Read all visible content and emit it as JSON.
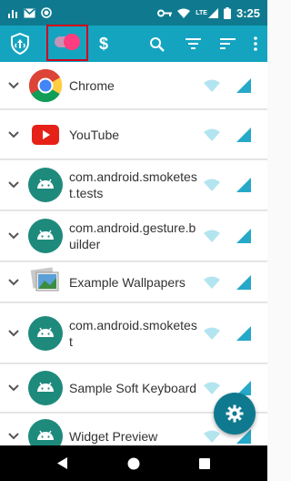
{
  "status_bar": {
    "time": "3:25",
    "network_label": "LTE",
    "icons": [
      "signal-bars-icon",
      "gmail-icon",
      "sync-icon",
      "vpn-key-icon",
      "wifi-icon",
      "cell-signal-icon",
      "battery-icon"
    ]
  },
  "app_bar": {
    "icons": [
      "shield-logo-icon",
      "toggle-switch",
      "dollar-icon",
      "search-icon",
      "filter-icon",
      "sort-icon",
      "more-vert-icon"
    ],
    "currency_symbol": "$"
  },
  "apps": [
    {
      "label": "Chrome",
      "icon": "chrome-icon"
    },
    {
      "label": "YouTube",
      "icon": "youtube-icon"
    },
    {
      "label": "com.android.smoketest.tests",
      "icon": "android-icon"
    },
    {
      "label": "com.android.gesture.builder",
      "icon": "android-icon"
    },
    {
      "label": "Example Wallpapers",
      "icon": "wallpapers-icon"
    },
    {
      "label": "com.android.smoketest",
      "icon": "android-icon"
    },
    {
      "label": "Sample Soft Keyboard",
      "icon": "android-icon"
    },
    {
      "label": "Widget Preview",
      "icon": "android-icon"
    }
  ],
  "colors": {
    "app_bar": "#14a4c0",
    "status_bar": "#0f7a8f",
    "accent_pink": "#ff3d7f",
    "status_icon": "#b3e5f0",
    "highlight_box": "#d0021b"
  }
}
